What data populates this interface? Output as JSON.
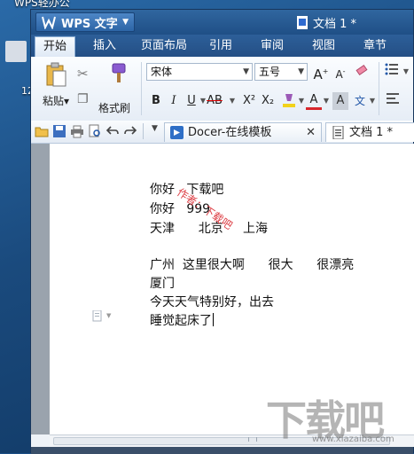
{
  "desktop": {
    "icon_label": "WPS轻办公",
    "icon_fragment_text": "12"
  },
  "window": {
    "app_button_label": "WPS 文字",
    "document_title": "文档 1 *"
  },
  "menu": {
    "items": [
      "开始",
      "插入",
      "页面布局",
      "引用",
      "审阅",
      "视图",
      "章节"
    ],
    "active": "开始"
  },
  "ribbon": {
    "paste_label": "粘贴",
    "format_painter_label": "格式刷",
    "font_name": "宋体",
    "font_size": "五号",
    "bold": "B",
    "italic": "I",
    "underline": "U",
    "strikethrough": "AB",
    "superscript": "X²",
    "subscript": "X₂",
    "font_color": "A",
    "char_shading": "A",
    "phonetic": "文"
  },
  "quickbar": {
    "tabs": [
      {
        "label": "Docer-在线模板",
        "closable": true
      },
      {
        "label": "文档 1 *",
        "closable": false
      }
    ]
  },
  "document": {
    "lines": [
      "你好   下载吧",
      "你好   999",
      "天津      北京     上海",
      "",
      "广州  这里很大啊      很大      很漂亮",
      "厦门",
      "今天天气特别好，出去",
      "睡觉起床了"
    ],
    "watermark": "作者：下载吧"
  },
  "colors": {
    "titlebar": "#1f4f86",
    "active_tab": "#eef4fb",
    "watermark": "#d9282f",
    "highlight_yellow": "#f2d21b",
    "font_color_red": "#d8262c"
  },
  "site_logo": {
    "main": "下载吧",
    "sub": "www.xiazaiba.com"
  }
}
